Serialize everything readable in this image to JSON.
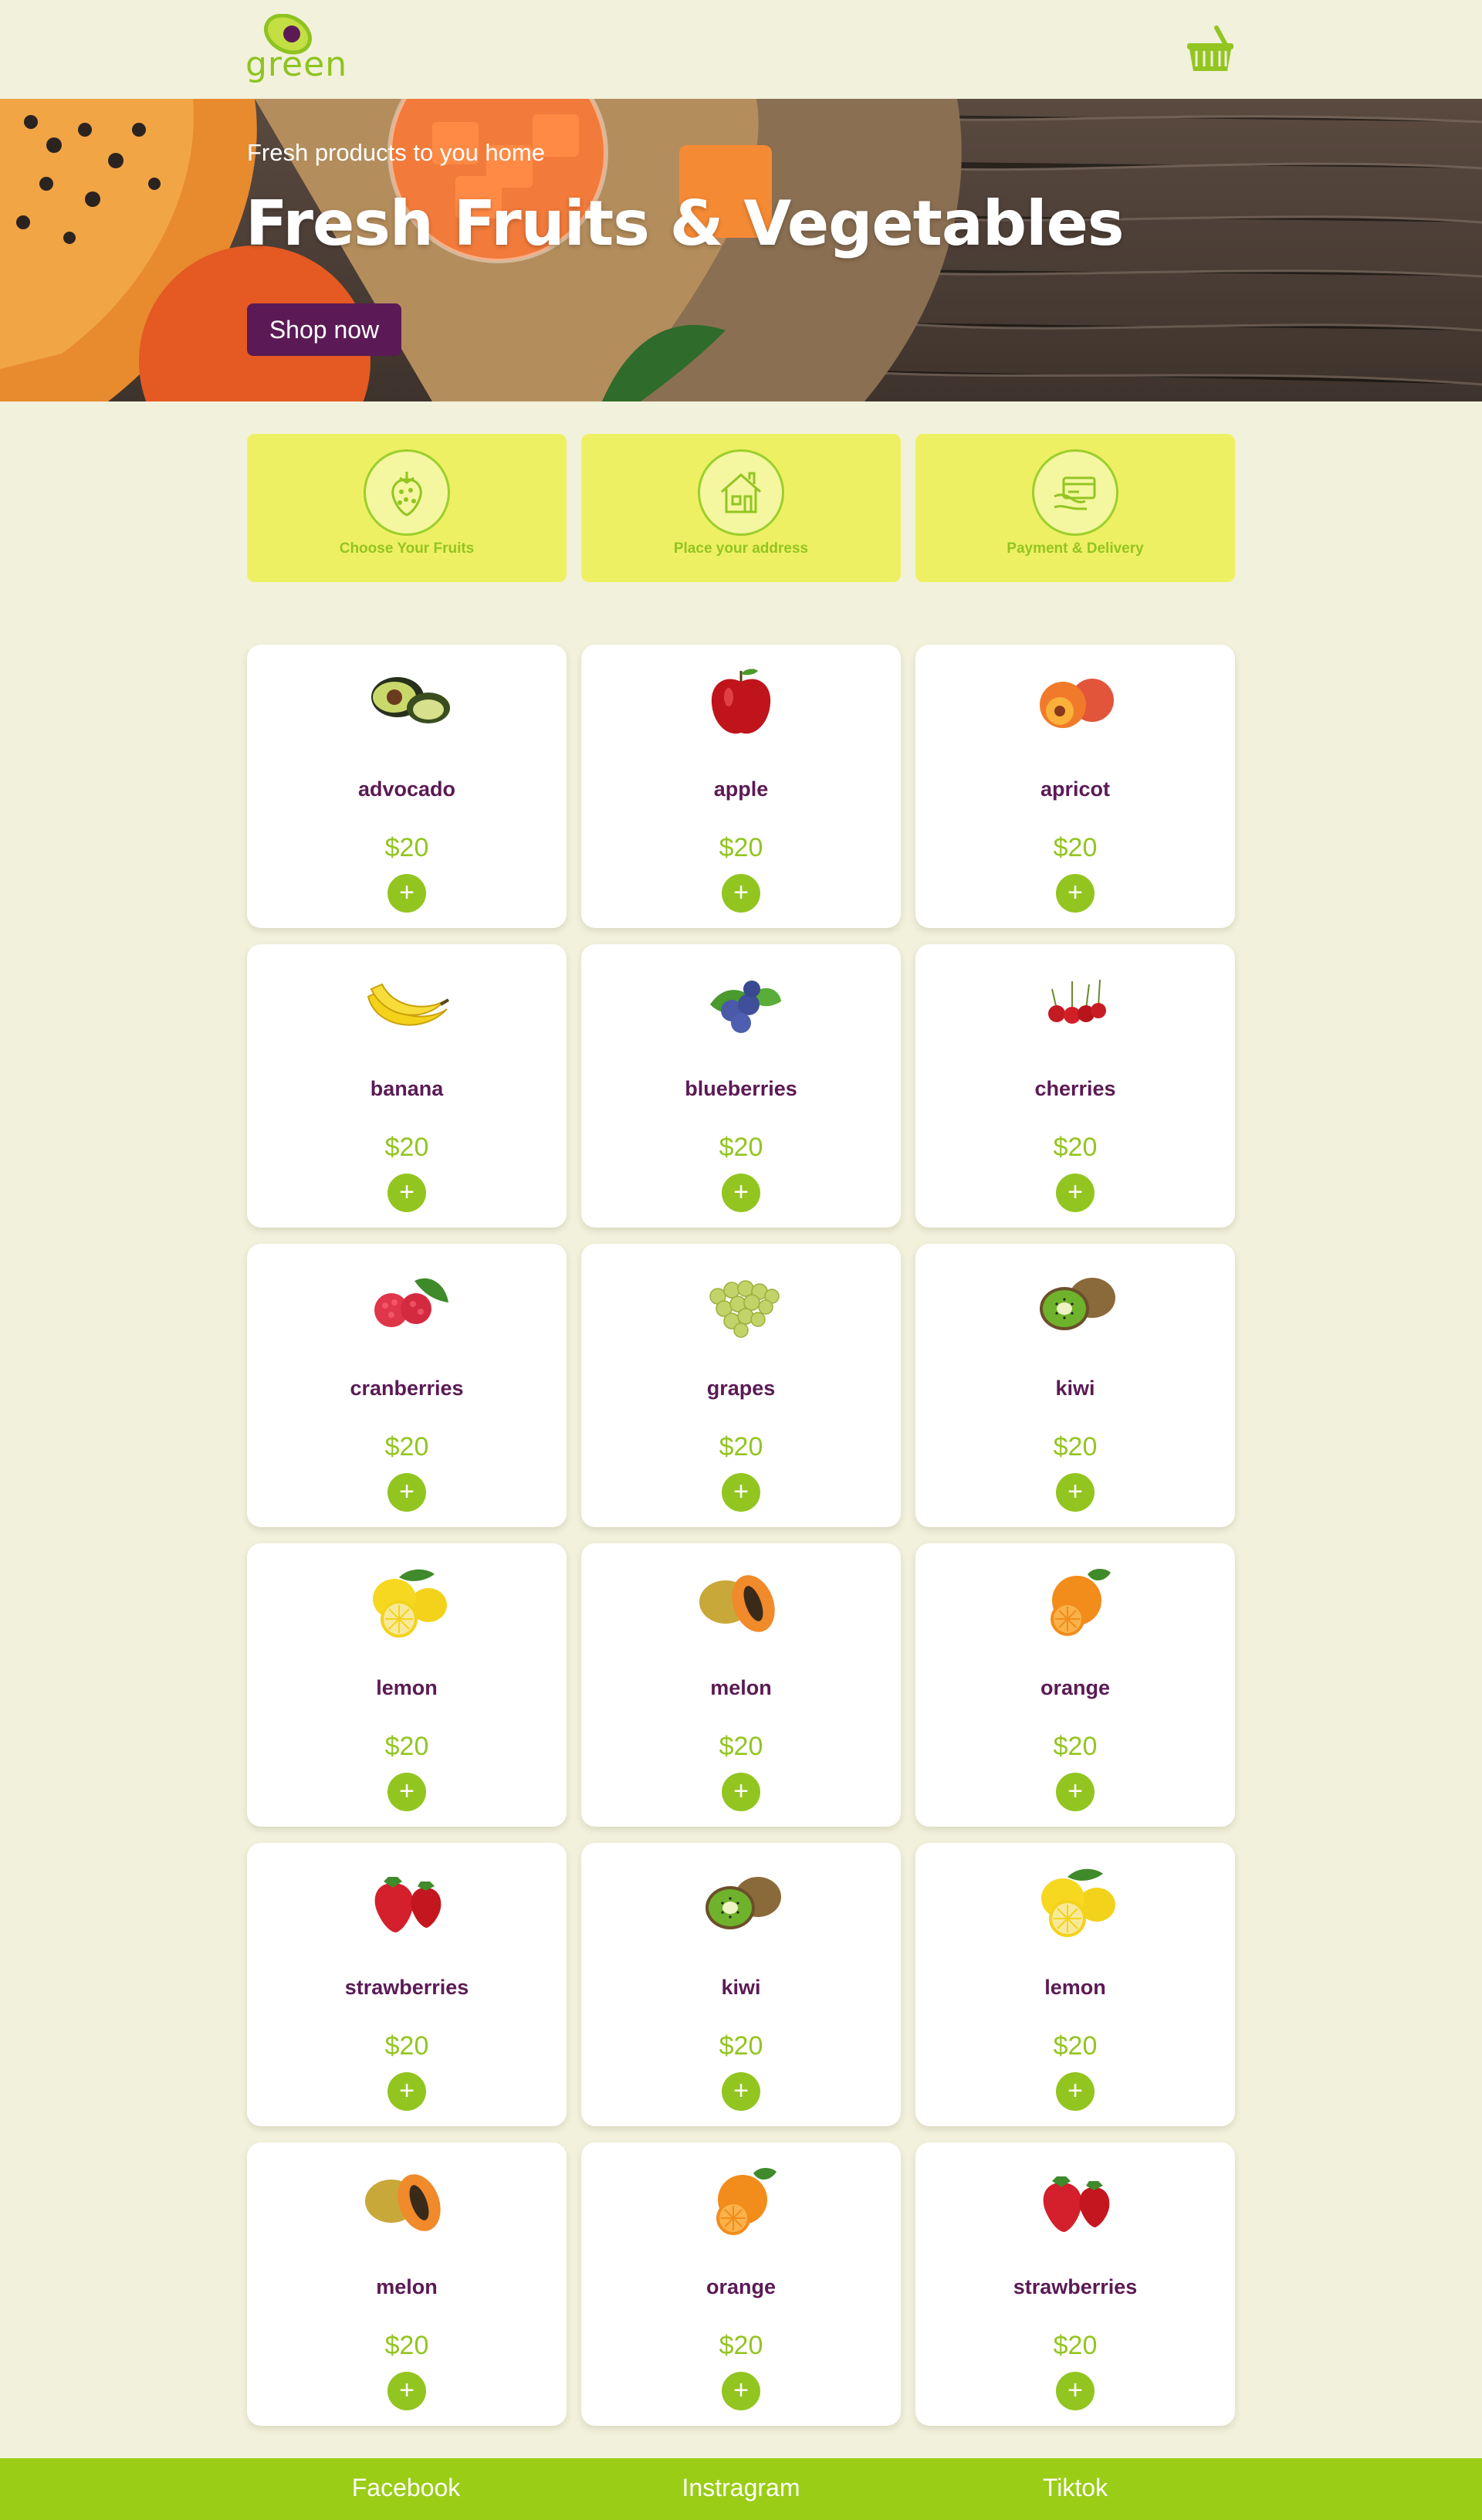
{
  "header": {
    "logo_text": "green",
    "logo_icon": "avocado-logo-icon",
    "cart_icon": "basket-icon"
  },
  "hero": {
    "subtitle": "Fresh products to you home",
    "title": "Fresh Fruits & Vegetables",
    "cta_label": "Shop now",
    "cta_color": "#5b1a55"
  },
  "steps": [
    {
      "label": "Choose Your Fruits",
      "icon": "strawberry-icon"
    },
    {
      "label": "Place your address",
      "icon": "house-icon"
    },
    {
      "label": "Payment & Delivery",
      "icon": "card-payment-icon"
    }
  ],
  "products": [
    {
      "name": "advocado",
      "price": "$20",
      "icon": "avocado"
    },
    {
      "name": "apple",
      "price": "$20",
      "icon": "apple"
    },
    {
      "name": "apricot",
      "price": "$20",
      "icon": "apricot"
    },
    {
      "name": "banana",
      "price": "$20",
      "icon": "banana"
    },
    {
      "name": "blueberries",
      "price": "$20",
      "icon": "blueberries"
    },
    {
      "name": "cherries",
      "price": "$20",
      "icon": "cherries"
    },
    {
      "name": "cranberries",
      "price": "$20",
      "icon": "raspberries"
    },
    {
      "name": "grapes",
      "price": "$20",
      "icon": "grapes"
    },
    {
      "name": "kiwi",
      "price": "$20",
      "icon": "kiwi"
    },
    {
      "name": "lemon",
      "price": "$20",
      "icon": "lemon"
    },
    {
      "name": "melon",
      "price": "$20",
      "icon": "papaya"
    },
    {
      "name": "orange",
      "price": "$20",
      "icon": "orange"
    },
    {
      "name": "strawberries",
      "price": "$20",
      "icon": "strawberries"
    },
    {
      "name": "kiwi",
      "price": "$20",
      "icon": "kiwi"
    },
    {
      "name": "lemon",
      "price": "$20",
      "icon": "lemon"
    },
    {
      "name": "melon",
      "price": "$20",
      "icon": "papaya"
    },
    {
      "name": "orange",
      "price": "$20",
      "icon": "orange"
    },
    {
      "name": "strawberries",
      "price": "$20",
      "icon": "strawberries"
    }
  ],
  "add_button_label": "+",
  "footer": {
    "links": [
      "Facebook",
      "Instragram",
      "Tiktok"
    ]
  },
  "colors": {
    "background": "#f1f1dc",
    "accent_green": "#93c521",
    "brand_purple": "#5b1a55",
    "step_yellow": "#eef064",
    "footer_green": "#9acd15"
  }
}
